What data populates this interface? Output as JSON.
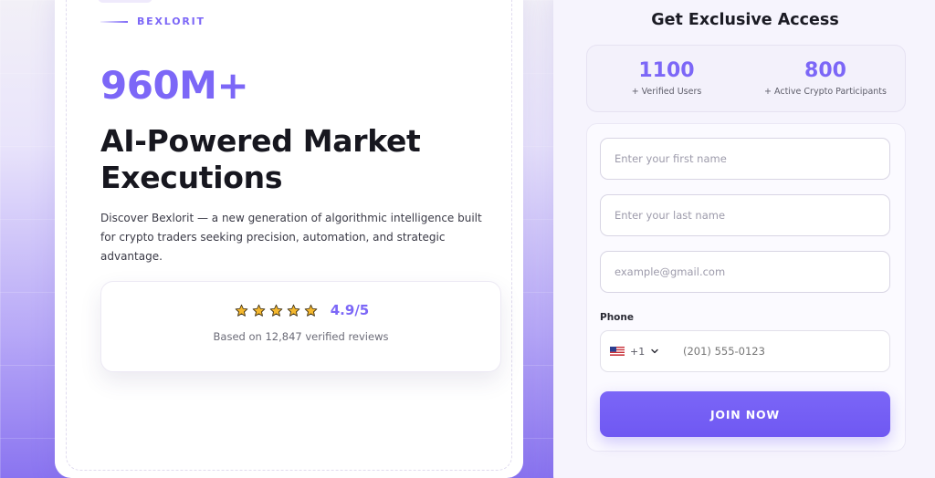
{
  "brand": {
    "name": "BEXLORIT"
  },
  "hero": {
    "big_number": "960M+",
    "headline": "AI-Powered Market Executions",
    "description": "Discover Bexlorit — a new generation of algorithmic intelligence built for crypto traders seeking precision, automation, and strategic advantage."
  },
  "rating": {
    "stars": 5,
    "value": "4.9/5",
    "reviews_text": "Based on 12,847 verified reviews",
    "star_color": "#f5b82e"
  },
  "form": {
    "title": "Get Exclusive Access",
    "stats": [
      {
        "number": "1100",
        "label": "+ Verified Users"
      },
      {
        "number": "800",
        "label": "+ Active Crypto Participants"
      }
    ],
    "first_name_placeholder": "Enter your first name",
    "last_name_placeholder": "Enter your last name",
    "email_placeholder": "example@gmail.com",
    "phone_label": "Phone",
    "country_flag": "us-flag-icon",
    "dial_code": "+1",
    "phone_placeholder": "(201) 555-0123",
    "submit_label": "JOIN NOW"
  },
  "colors": {
    "accent": "#7c67f7",
    "heading": "#17171f",
    "button": "#7260f3"
  }
}
